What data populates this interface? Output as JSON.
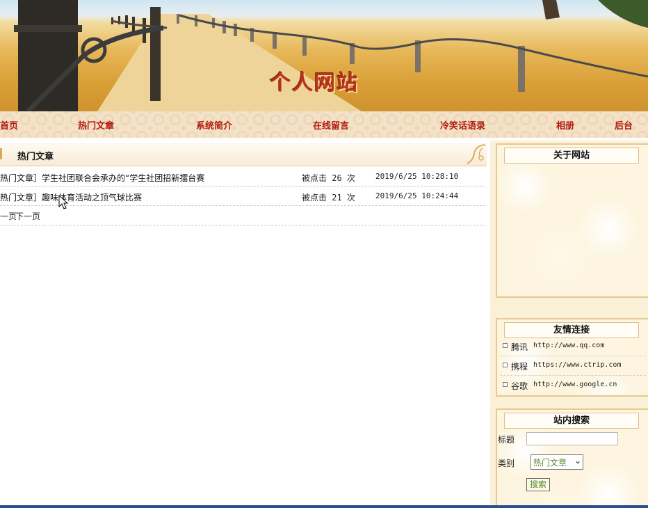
{
  "header": {
    "site_title": "个人网站"
  },
  "nav": {
    "items": [
      {
        "label": "首页"
      },
      {
        "label": "热门文章"
      },
      {
        "label": "系统简介"
      },
      {
        "label": "在线留言"
      },
      {
        "label": "冷笑话语录"
      },
      {
        "label": "相册"
      },
      {
        "label": "后台"
      }
    ],
    "text_color": "#b3190e"
  },
  "main": {
    "section_title": "热门文章",
    "articles": [
      {
        "title": "热门文章］学生社团联合会承办的“学生社团招新擂台赛",
        "clicks": "被点击 26 次",
        "time": "2019/6/25 10:28:10"
      },
      {
        "title": "热门文章］趣味体育活动之顶气球比赛",
        "clicks": "被点击 21 次",
        "time": "2019/6/25 10:24:44"
      }
    ],
    "pager": {
      "prev": "一页",
      "next": "下一页"
    }
  },
  "sidebar": {
    "about": {
      "title": "关于网站"
    },
    "links": {
      "title": "友情连接",
      "items": [
        {
          "name": "腾讯",
          "url": "http://www.qq.com"
        },
        {
          "name": "携程",
          "url": "https://www.ctrip.com"
        },
        {
          "name": "谷歌",
          "url": "http://www.google.cn"
        }
      ]
    },
    "search": {
      "title": "站内搜索",
      "title_label": "标题",
      "category_label": "类别",
      "category_value": "热门文章",
      "button": "搜索",
      "title_value": ""
    }
  },
  "colors": {
    "accent": "#b3190e",
    "panel_border": "#e7c98f",
    "bottom_bar": "#2a4f8f"
  }
}
